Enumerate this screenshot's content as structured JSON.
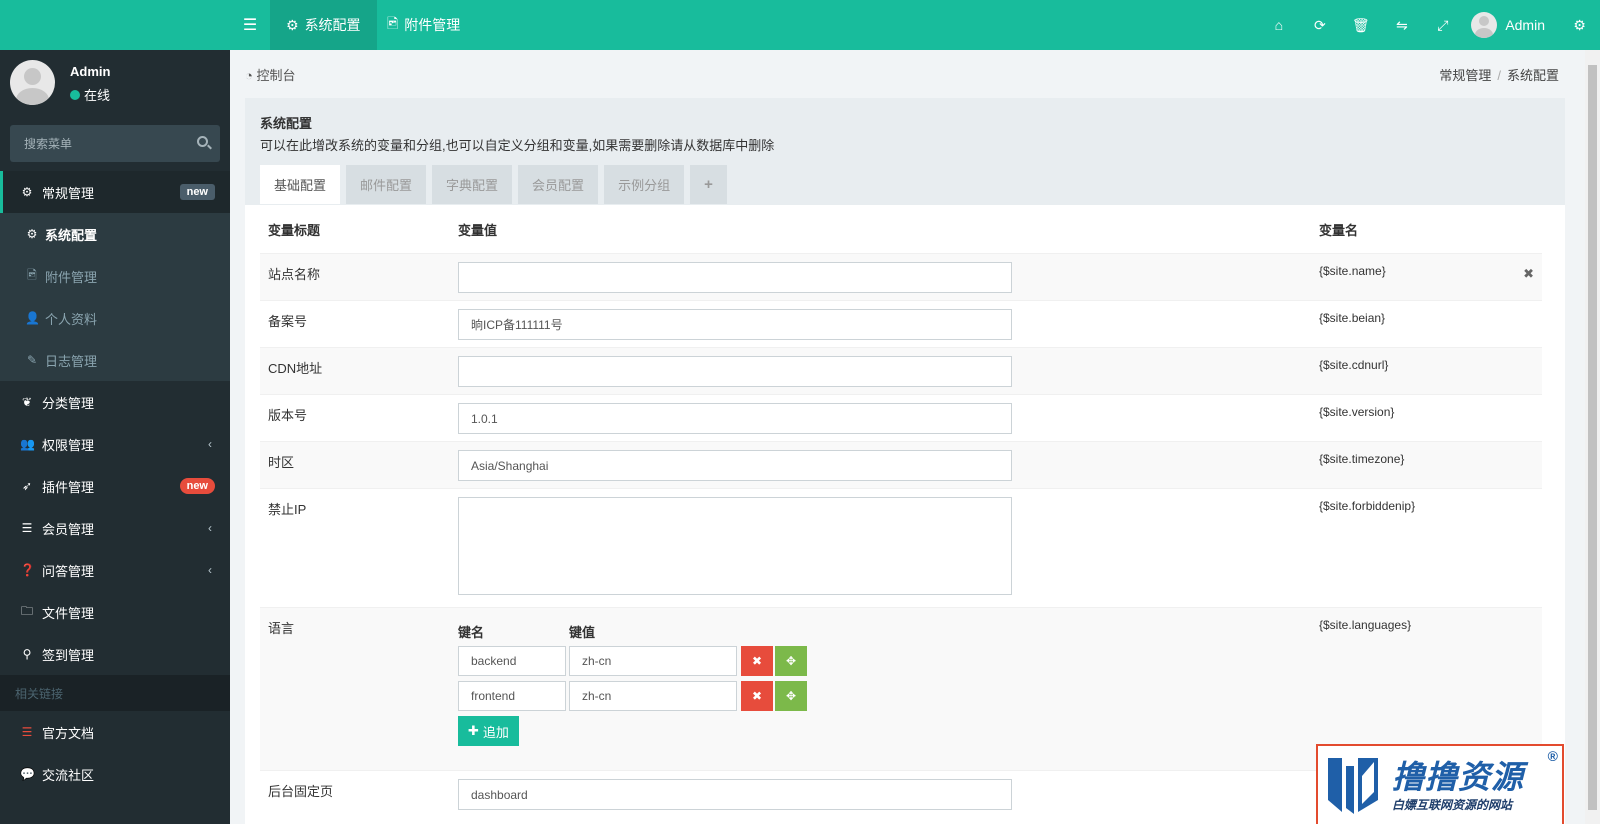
{
  "sidebar": {
    "user": {
      "name": "Admin",
      "status": "在线"
    },
    "search_placeholder": "搜索菜单",
    "menu": [
      {
        "icon": "cogs-icon",
        "glyph": "⚙",
        "label": "常规管理",
        "badge": "new",
        "badge_color": "gray",
        "active": true
      },
      {
        "icon": "leaf-icon",
        "glyph": "❦",
        "label": "分类管理"
      },
      {
        "icon": "group-icon",
        "glyph": "👥",
        "label": "权限管理",
        "arrow": "‹"
      },
      {
        "icon": "rocket-icon",
        "glyph": "➶",
        "label": "插件管理",
        "badge": "new",
        "badge_color": "red"
      },
      {
        "icon": "list-icon",
        "glyph": "☰",
        "label": "会员管理",
        "arrow": "‹"
      },
      {
        "icon": "question-icon",
        "glyph": "❓",
        "label": "问答管理",
        "arrow": "‹"
      },
      {
        "icon": "folder-icon",
        "glyph": "🗀",
        "label": "文件管理"
      },
      {
        "icon": "map-marker-icon",
        "glyph": "⚲",
        "label": "签到管理"
      }
    ],
    "submenu": [
      {
        "icon": "gear-icon",
        "glyph": "⚙",
        "label": "系统配置",
        "current": true
      },
      {
        "icon": "file-image-icon",
        "glyph": "🖻",
        "label": "附件管理"
      },
      {
        "icon": "user-icon",
        "glyph": "👤",
        "label": "个人资料"
      },
      {
        "icon": "pencil-icon",
        "glyph": "✎",
        "label": "日志管理"
      }
    ],
    "links_header": "相关链接",
    "links": [
      {
        "icon": "list-icon",
        "glyph": "☰",
        "label": "官方文档",
        "color": "#e74c3c"
      },
      {
        "icon": "comments-icon",
        "glyph": "💬",
        "label": "交流社区",
        "color": "#f39c12"
      }
    ]
  },
  "navbar": {
    "tabs": [
      {
        "icon": "gear-icon",
        "glyph": "⚙",
        "label": "系统配置",
        "active": true
      },
      {
        "icon": "file-image-icon",
        "glyph": "🖻",
        "label": "附件管理"
      }
    ],
    "user": "Admin"
  },
  "breadcrumb": {
    "left": "控制台",
    "items": [
      "常规管理",
      "系统配置"
    ]
  },
  "panel": {
    "title": "系统配置",
    "description": "可以在此增改系统的变量和分组,也可以自定义分组和变量,如果需要删除请从数据库中删除",
    "tabs": [
      "基础配置",
      "邮件配置",
      "字典配置",
      "会员配置",
      "示例分组",
      "+"
    ],
    "columns": [
      "变量标题",
      "变量值",
      "变量名"
    ],
    "rows": [
      {
        "label": "站点名称",
        "value": "",
        "var": "{$site.name}",
        "deletable": true
      },
      {
        "label": "备案号",
        "value": "晌ICP备111111号",
        "var": "{$site.beian}"
      },
      {
        "label": "CDN地址",
        "value": "",
        "var": "{$site.cdnurl}"
      },
      {
        "label": "版本号",
        "value": "1.0.1",
        "var": "{$site.version}"
      },
      {
        "label": "时区",
        "value": "Asia/Shanghai",
        "var": "{$site.timezone}"
      },
      {
        "label": "禁止IP",
        "value": "",
        "var": "{$site.forbiddenip}"
      }
    ],
    "language": {
      "label": "语言",
      "var": "{$site.languages}",
      "key_header": "键名",
      "value_header": "键值",
      "pairs": [
        {
          "key": "backend",
          "value": "zh-cn"
        },
        {
          "key": "frontend",
          "value": "zh-cn"
        }
      ],
      "add_label": "追加"
    },
    "fixed_page": {
      "label": "后台固定页",
      "value": "dashboard"
    }
  },
  "watermark": {
    "title": "撸撸资源",
    "subtitle": "白嫖互联网资源的网站",
    "reg": "®"
  },
  "colors": {
    "brand": "#18bc9c",
    "sidebar_bg": "#222d32",
    "danger": "#e74c3c",
    "success": "#7cb94a"
  }
}
